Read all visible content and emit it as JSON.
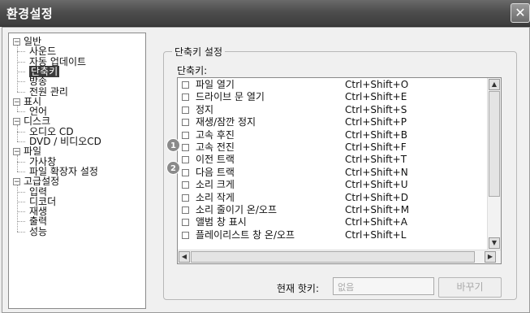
{
  "window": {
    "title": "환경설정",
    "close_symbol": "✕"
  },
  "tree": {
    "collapse_symbol": "−",
    "groups": [
      {
        "label": "일반",
        "children": [
          "사운드",
          "자동 업데이트",
          "단축키",
          "방송",
          "전원 관리"
        ]
      },
      {
        "label": "표시",
        "children": [
          "언어"
        ]
      },
      {
        "label": "디스크",
        "children": [
          "오디오 CD",
          "DVD / 비디오CD"
        ]
      },
      {
        "label": "파일",
        "children": [
          "가사창",
          "파일 확장자 설정"
        ]
      },
      {
        "label": "고급설정",
        "children": [
          "입력",
          "디코더",
          "재생",
          "출력",
          "성능"
        ]
      }
    ],
    "selected": "단축키"
  },
  "panel": {
    "group_title": "단축키 설정",
    "list_label": "단축키:",
    "items": [
      {
        "name": "파일 열기",
        "key": "Ctrl+Shift+O"
      },
      {
        "name": "드라이브 문 열기",
        "key": "Ctrl+Shift+E"
      },
      {
        "name": "정지",
        "key": "Ctrl+Shift+S"
      },
      {
        "name": "재생/잠깐 정지",
        "key": "Ctrl+Shift+P"
      },
      {
        "name": "고속 후진",
        "key": "Ctrl+Shift+B"
      },
      {
        "name": "고속 전진",
        "key": "Ctrl+Shift+F"
      },
      {
        "name": "이전 트랙",
        "key": "Ctrl+Shift+T"
      },
      {
        "name": "다음 트랙",
        "key": "Ctrl+Shift+N"
      },
      {
        "name": "소리 크게",
        "key": "Ctrl+Shift+U"
      },
      {
        "name": "소리 작게",
        "key": "Ctrl+Shift+D"
      },
      {
        "name": "소리 줄이기 온/오프",
        "key": "Ctrl+Shift+M"
      },
      {
        "name": "앨범 창 표시",
        "key": "Ctrl+Shift+A"
      },
      {
        "name": "플레이리스트 창 온/오프",
        "key": "Ctrl+Shift+L"
      }
    ],
    "markers": [
      "1",
      "2"
    ],
    "scroll": {
      "up": "▲",
      "down": "▼",
      "left": "◀",
      "right": "▶"
    },
    "hotkey_label": "현재 핫키:",
    "hotkey_value": "없음",
    "change_button": "바꾸기"
  }
}
